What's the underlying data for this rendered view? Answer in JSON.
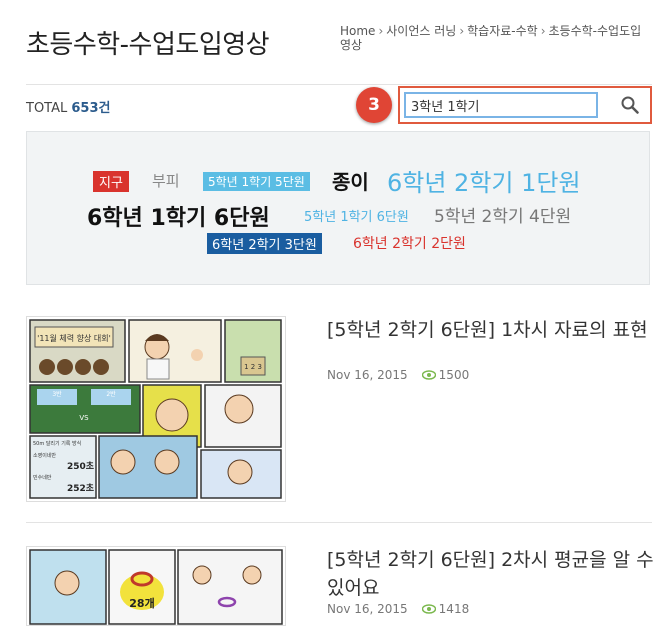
{
  "page": {
    "title": "초등수학-수업도입영상"
  },
  "breadcrumb": {
    "home": "Home",
    "item1": "사이언스 러닝",
    "item2": "학습자료-수학",
    "item3": "초등수학-수업도입영상"
  },
  "list": {
    "total_label": "TOTAL",
    "total_count": "653건"
  },
  "search": {
    "value": "3학년 1학기",
    "step_number": "3"
  },
  "tags": [
    "지구",
    "부피",
    "5학년 1학기 5단원",
    "종이",
    "6학년 2학기 1단원",
    "6학년 1학기 6단원",
    "5학년 1학기 6단원",
    "5학년 2학기 4단원",
    "6학년 2학기 3단원",
    "6학년 2학기 2단원"
  ],
  "posts": [
    {
      "title": "[5학년 2학기 6단원] 1차시 자료의 표현",
      "date": "Nov 16, 2015",
      "views": "1500",
      "thumb": {
        "banner": "'11월 체력 향상 대회'",
        "label_a": "3반",
        "label_b": "2반",
        "vs": "VS",
        "record_title": "50m 달리기 기록 방식",
        "row1_label": "소영이네반",
        "row1_value": "250초",
        "row2_label": "민수네반",
        "row2_value": "252초",
        "podium": "1 2 3"
      }
    },
    {
      "title": "[5학년 2학기 6단원] 2차시 평균을 알 수 있어요",
      "date": "Nov 16, 2015",
      "views": "1418",
      "thumb": {
        "count": "28개"
      }
    }
  ],
  "colors": {
    "accent_red": "#d9332d",
    "link_blue": "#4fb3e3",
    "navy": "#1a5da0",
    "highlight_border": "#e05a3e"
  }
}
